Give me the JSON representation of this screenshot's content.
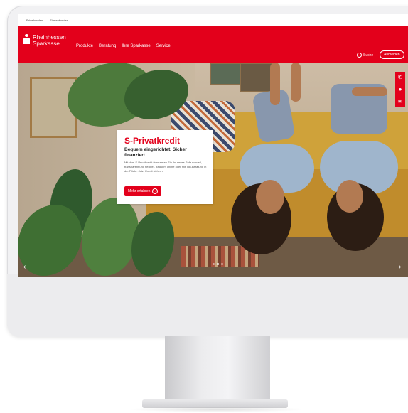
{
  "toplinks": [
    "Privatkunden",
    "Firmenkunden"
  ],
  "brand": {
    "line1": "Rheinhessen",
    "line2": "Sparkasse",
    "color": "#e3001b"
  },
  "nav": [
    "Produkte",
    "Beratung",
    "Ihre Sparkasse",
    "Service"
  ],
  "search_label": "Suche",
  "login_label": "Anmelden",
  "hero": {
    "title": "S-Privatkredit",
    "subtitle": "Bequem eingerichtet. Sicher finanziert.",
    "body": "Mit dem S-Privatkredit finanzieren Sie Ihr neues Sofa schnell, transparent und flexibel. Bequem online oder mit Top-Beratung in der Filiale. Jetzt Kredit sichern.",
    "cta": "Mehr erfahren",
    "cta_icon": "chevron-right-icon"
  },
  "contact_icons": [
    "phone-icon",
    "chat-icon",
    "mail-icon"
  ],
  "carousel": {
    "slides": 3,
    "active": 2,
    "prev_icon": "chevron-left-icon",
    "next_icon": "chevron-right-icon"
  }
}
